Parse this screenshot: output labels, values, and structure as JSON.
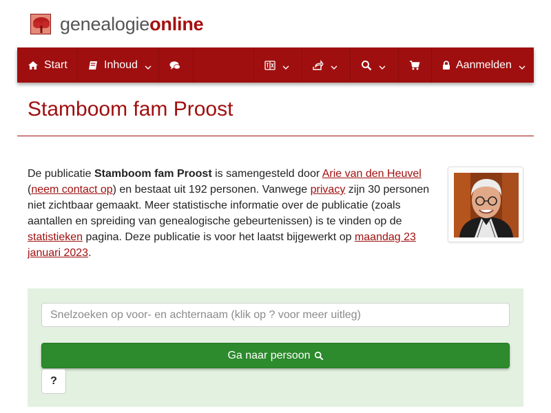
{
  "logo": {
    "part1": "genealogie",
    "part2": "online"
  },
  "nav": {
    "start": "Start",
    "inhoud": "Inhoud",
    "chat_icon": "comments-icon",
    "language_icon": "language-icon",
    "share_icon": "share-icon",
    "search_icon": "search-icon",
    "cart_icon": "cart-icon",
    "login": "Aanmelden"
  },
  "page": {
    "title": "Stamboom fam Proost"
  },
  "intro": {
    "t1": "De publicatie ",
    "pub_name": "Stamboom fam Proost",
    "t2": " is samengesteld door ",
    "author": "Arie van den Heuvel",
    "t3": "(",
    "contact": "neem contact op",
    "t4": ") en bestaat uit 192 personen. Vanwege ",
    "privacy": "privacy",
    "t5": " zijn 30 personen niet zichtbaar gemaakt. Meer statistische informatie over de publicatie (zoals aantallen en spreiding van genealogische gebeurtenissen) is te vinden op de ",
    "stats": "statistieken",
    "t6": " pagina. Deze publicatie is voor het laatst bijgewerkt op ",
    "date": "maandag 23 januari 2023",
    "t7": "."
  },
  "search": {
    "placeholder": "Snelzoeken op voor- en achternaam (klik op ? voor meer uitleg)",
    "go_label": "Ga naar persoon",
    "help_label": "?"
  },
  "colors": {
    "brand": "#a00f0f",
    "panel": "#e3f1e0",
    "button": "#2d8a2d"
  }
}
